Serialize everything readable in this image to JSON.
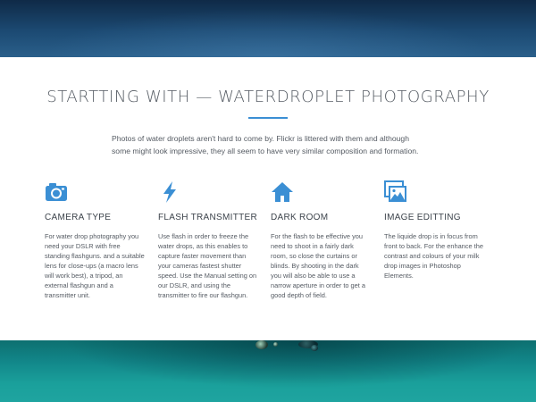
{
  "section": {
    "title": "STARTTING WITH — WATERDROPLET PHOTOGRAPHY",
    "intro": "Photos of water droplets aren't hard to come by. Flickr is littered with them and although some might look impressive, they all seem to have very similar composition and formation."
  },
  "features": [
    {
      "icon": "camera-icon",
      "title": "CAMERA TYPE",
      "description": "For water drop photography you need your DSLR with free standing flashguns. and a suitable lens for close-ups (a macro lens will work best), a tripod, an external flashgun and a transmitter unit."
    },
    {
      "icon": "lightning-bolt-icon",
      "title": "FLASH TRANSMITTER",
      "description": "Use flash in order to freeze the water drops, as this enables to capture faster movement than your cameras fastest shutter speed. Use the Manual setting on our DSLR, and using the transmitter to fire our flashgun."
    },
    {
      "icon": "home-icon",
      "title": "DARK ROOM",
      "description": "For the flash to be effective you need to shoot in a fairly dark room, so close the curtains or blinds. By shooting in the dark you will also be able to use a narrow aperture in order to get a good depth of field."
    },
    {
      "icon": "images-icon",
      "title": "IMAGE EDITTING",
      "description": "The liquide drop is in focus from front to back. For the enhance the contrast and colours of your milk drop images in Photoshop Elements."
    }
  ],
  "colors": {
    "accent": "#3b8fd4",
    "text": "#555b63",
    "heading": "#3c434b"
  }
}
